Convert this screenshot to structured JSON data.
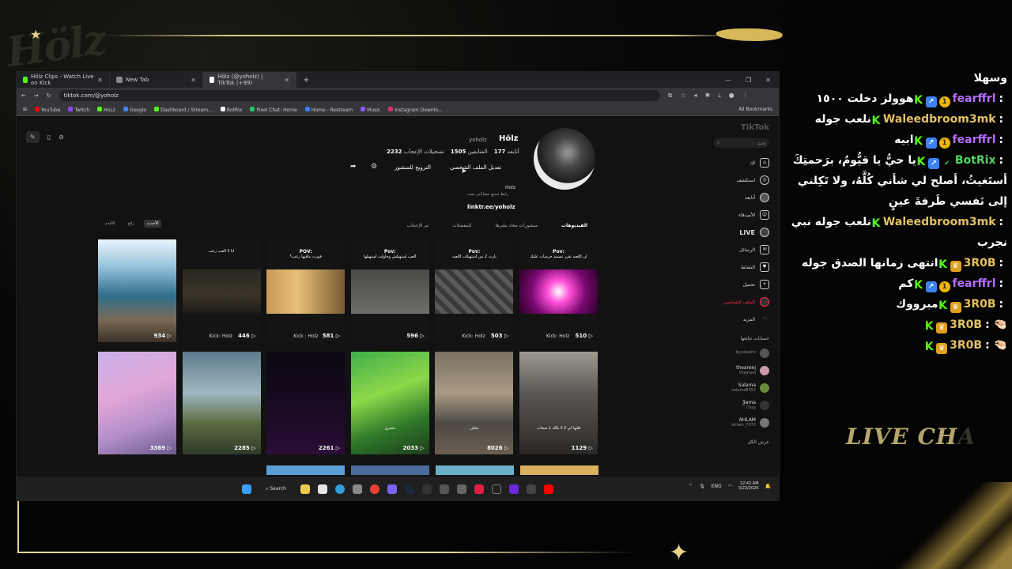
{
  "overlay": {
    "logo_text": "Hölz",
    "chat_watermark_left": "LIVE CH",
    "chat_watermark_right": "A"
  },
  "browser": {
    "tabs": [
      {
        "label": "Hölz Clips - Watch Live on Kick",
        "favicon_color": "#53fc18"
      },
      {
        "label": "New Tab",
        "favicon_color": "#888888"
      },
      {
        "label": "Hölz (@yoholz) | TikTok (+99)",
        "favicon_color": "#ffffff"
      }
    ],
    "url": "tiktok.com/@yoholz",
    "bookmarks": [
      "YouTube",
      "Twitch",
      "HoLz",
      "Google",
      "Dashboard / Stream...",
      "BotRix",
      "Pixel Chat: Home",
      "Home - Restream",
      "Music",
      "Instagram Downlo..."
    ],
    "all_bookmarks": "All Bookmarks"
  },
  "tiktok": {
    "logo": "TikTok",
    "search_placeholder": "بحث",
    "nav": [
      {
        "label": "لك",
        "icon": "home-icon"
      },
      {
        "label": "استكشف",
        "icon": "explore-icon"
      },
      {
        "label": "أتابعه",
        "icon": "following-icon"
      },
      {
        "label": "الأصدقاء",
        "icon": "friends-icon"
      },
      {
        "label": "LIVE",
        "icon": "live-icon"
      },
      {
        "label": "الرسائل",
        "icon": "messages-icon"
      },
      {
        "label": "النشاط",
        "icon": "activity-icon"
      },
      {
        "label": "تحميل",
        "icon": "upload-icon"
      },
      {
        "label": "الملف الشخصي",
        "icon": "profile-icon"
      },
      {
        "label": "المزيد",
        "icon": "more-icon"
      }
    ],
    "following_title": "حسابات تتابعها",
    "following": [
      {
        "name": "",
        "handle": "byyalazmi"
      },
      {
        "name": "theareej",
        "handle": "theareej"
      },
      {
        "name": "Salama",
        "handle": "salama8352"
      },
      {
        "name": "Ѯama",
        "handle": "l7ujy"
      },
      {
        "name": "AHLAM",
        "handle": "ahlam_7072"
      }
    ],
    "show_all": "عرض الكل",
    "profile": {
      "name": "Hölz",
      "handle": "yoholz",
      "following_count": "177",
      "following_label": "أتابعه",
      "followers_count": "1505",
      "followers_label": "المتابعين",
      "likes_count": "2232",
      "likes_label": "تسجيلات الإعجاب",
      "edit_button": "تعديل الملف الشخصي",
      "promote_button": "الترويج للمنشور",
      "bio_name": "Holz",
      "bio": "رابط جميع حساباتي تحت",
      "link": "linktr.ee/yoholz"
    },
    "tabs": [
      "الفيديوهات",
      "منشورات معاد نشرها",
      "المفضلات",
      "تم الإعجاب"
    ],
    "sort": [
      "الأحدث",
      "رائج",
      "الأقدم"
    ],
    "videos": [
      {
        "views": "934",
        "header": "",
        "sub": "",
        "kick": "",
        "caption": "",
        "theme": "sea"
      },
      {
        "views": "446",
        "header": "",
        "sub": "انا لا العب رعب",
        "kick": "Kick: Holz",
        "caption": "",
        "theme": "dark"
      },
      {
        "views": "581",
        "header": "POV:",
        "sub": "فورت مافيها رعب؟",
        "kick": "Kick : Holz",
        "caption": "",
        "theme": "door"
      },
      {
        "views": "596",
        "header": "Pov:",
        "sub": "العب استهبلش وحاولت استهبلها",
        "kick": "",
        "caption": "",
        "theme": "room"
      },
      {
        "views": "503",
        "header": "Pov:",
        "sub": "بارت 2 من استهبلات اللعبة",
        "kick": "Kick: Holz",
        "caption": "",
        "theme": "tile"
      },
      {
        "views": "510",
        "header": "Pov:",
        "sub": "لن اللعبه تقرر تسمم خرشات عليك",
        "kick": "Kick: Holz",
        "caption": "",
        "theme": "pink"
      },
      {
        "views": "3369",
        "header": "",
        "sub": "",
        "kick": "",
        "caption": "",
        "theme": "fort"
      },
      {
        "views": "2285",
        "header": "",
        "sub": "",
        "kick": "",
        "caption": "",
        "theme": "build"
      },
      {
        "views": "2261",
        "header": "",
        "sub": "",
        "kick": "",
        "caption": "",
        "theme": "purple"
      },
      {
        "views": "2033",
        "header": "",
        "sub": "",
        "kick": "",
        "caption": "شعري",
        "theme": "cactus"
      },
      {
        "views": "8026",
        "header": "",
        "sub": "",
        "kick": "",
        "caption": "نحاف",
        "theme": "office"
      },
      {
        "views": "1129",
        "header": "",
        "sub": "",
        "kick": "",
        "caption": "قلتها لي لا لا يالله يا سحاب",
        "theme": "car"
      }
    ]
  },
  "taskbar": {
    "search_label": "Search",
    "lang": "ENG",
    "time": "12:42 AM",
    "date": "3/23/2026"
  },
  "chat": {
    "messages": [
      {
        "badges": [],
        "user": "",
        "user_color": "#ffffff",
        "text": "وسهلا"
      },
      {
        "badges": [
          "kick",
          "rocket",
          "one"
        ],
        "user": "fearffrl",
        "user_color": "#b76cff",
        "text": "هوولز دخلت ١٥٠٠"
      },
      {
        "badges": [
          "kick"
        ],
        "user": "Waleedbroom3mk",
        "user_color": "#e3c062",
        "text": "نلعب جوله"
      },
      {
        "badges": [
          "kick",
          "rocket",
          "one"
        ],
        "user": "fearffrl",
        "user_color": "#b76cff",
        "text": "ابيه"
      },
      {
        "badges": [
          "kick",
          "rocket",
          "check"
        ],
        "user": "BotRix",
        "user_color": "#56d364",
        "text": "يا حيُّ يا قيُّومُ، برَحمتِكَ أستَغيثُ، أصلح لي شأني كُلَّهُ، ولا تَكِلني إلى نَفسي طَرفةَ عينٍ"
      },
      {
        "badges": [
          "kick"
        ],
        "user": "Waleedbroom3mk",
        "user_color": "#e3c062",
        "text": "نلعب جوله نبي نجرب"
      },
      {
        "badges": [
          "kick",
          "crown"
        ],
        "user": "3R0B",
        "user_color": "#e3c062",
        "text": "انتهى زمانها الصدق جوله"
      },
      {
        "badges": [
          "kick",
          "rocket",
          "one"
        ],
        "user": "fearffrl",
        "user_color": "#b76cff",
        "text": "كم"
      },
      {
        "badges": [
          "kick",
          "crown"
        ],
        "user": "3R0B",
        "user_color": "#e3c062",
        "text": "مبرووك"
      },
      {
        "badges": [
          "kick",
          "crown"
        ],
        "user": "3R0B",
        "user_color": "#e3c062",
        "text": "🤏🏻"
      },
      {
        "badges": [
          "kick",
          "crown"
        ],
        "user": "3R0B",
        "user_color": "#e3c062",
        "text": "🤏🏻"
      }
    ]
  }
}
